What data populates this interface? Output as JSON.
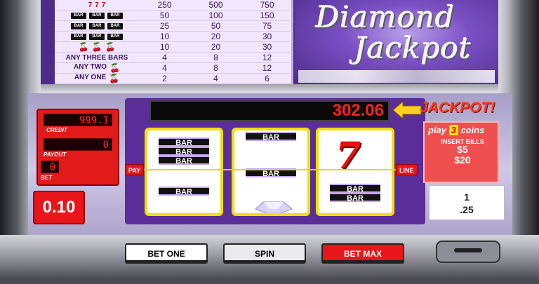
{
  "paytable": {
    "rows": [
      {
        "symbols": [
          {
            "kind": "seven",
            "text": "7"
          },
          {
            "kind": "seven",
            "text": "7"
          },
          {
            "kind": "seven",
            "text": "7"
          }
        ],
        "v1": "250",
        "v2": "500",
        "v3": "750"
      },
      {
        "symbols": [
          {
            "kind": "bar",
            "text": "BAR"
          },
          {
            "kind": "bar",
            "text": "BAR"
          },
          {
            "kind": "bar",
            "text": "BAR"
          }
        ],
        "v1": "50",
        "v2": "100",
        "v3": "150"
      },
      {
        "symbols": [
          {
            "kind": "bar",
            "text": "BAR"
          },
          {
            "kind": "bar",
            "text": "BAR"
          },
          {
            "kind": "bar",
            "text": "BAR"
          }
        ],
        "v1": "25",
        "v2": "50",
        "v3": "75"
      },
      {
        "symbols": [
          {
            "kind": "bar",
            "text": "BAR"
          },
          {
            "kind": "bar",
            "text": "BAR"
          },
          {
            "kind": "bar",
            "text": "BAR"
          }
        ],
        "v1": "10",
        "v2": "20",
        "v3": "30"
      },
      {
        "symbols": [
          {
            "kind": "cherry",
            "text": "🍒"
          },
          {
            "kind": "cherry",
            "text": "🍒"
          },
          {
            "kind": "cherry",
            "text": "🍒"
          }
        ],
        "v1": "10",
        "v2": "20",
        "v3": "30"
      },
      {
        "label": "ANY THREE BARS",
        "v1": "4",
        "v2": "8",
        "v3": "12"
      },
      {
        "label": "ANY TWO",
        "cherry": "🍒",
        "v1": "4",
        "v2": "8",
        "v3": "12"
      },
      {
        "label": "ANY ONE",
        "cherry": "🍒",
        "v1": "2",
        "v2": "4",
        "v3": "6"
      }
    ]
  },
  "logo": {
    "line1": "Diamond",
    "line2": "Jackpot"
  },
  "jackpot": {
    "value": "302.06",
    "label": "JACKPOT!"
  },
  "meters": {
    "credit": {
      "label": "CREDIT",
      "value": "999.1"
    },
    "payout": {
      "label": "PAYOUT",
      "value": "0"
    },
    "bet": {
      "label": "BET",
      "value": "0"
    }
  },
  "denomination": "0.10",
  "reels": {
    "reel1": {
      "top": [
        "BAR",
        "BAR",
        "BAR"
      ],
      "bottom": "BAR"
    },
    "reel2": {
      "top": "BAR",
      "mid": "BAR",
      "bottom": "diamond"
    },
    "reel3": {
      "top": "7",
      "bottom": [
        "BAR",
        "BAR"
      ]
    }
  },
  "payline": {
    "left": "PAY",
    "right": "LINE"
  },
  "info": {
    "play_prefix": "play",
    "coins_num": "3",
    "coins_suffix": "coins",
    "insert": "INSERT BILLS",
    "bill1": "$5",
    "bill2": "$20"
  },
  "bet_box": {
    "line1": "1",
    "line2": ".25"
  },
  "buttons": {
    "bet_one": "BET ONE",
    "spin": "SPIN",
    "bet_max": "BET MAX"
  },
  "colors": {
    "accent_red": "#e8151b",
    "reel_border": "#f0e000",
    "purple": "#5a2d99"
  }
}
